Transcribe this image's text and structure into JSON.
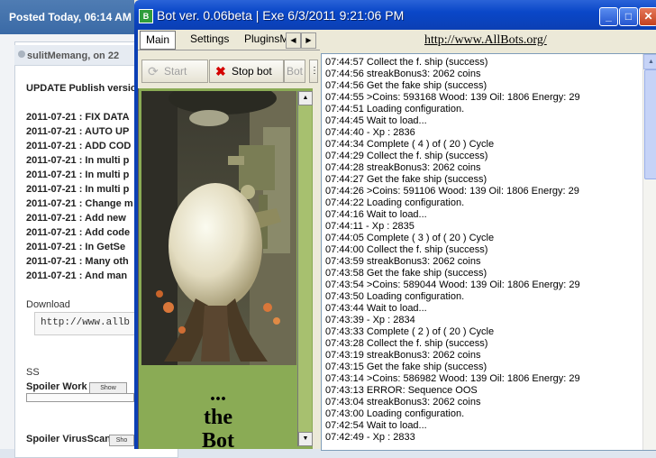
{
  "forum": {
    "posted": "Posted Today, 06:14 AM",
    "username": "sulitMemang, on 22",
    "lines": [
      "UPDATE Publish version",
      "2011-07-21 : FIX DATA",
      "2011-07-21 : AUTO UP",
      "2011-07-21 : ADD COD",
      "2011-07-21 : In multi p",
      "2011-07-21 : In multi p",
      "2011-07-21 : In multi p",
      "2011-07-21 : Change m",
      "2011-07-21 : Add new",
      "2011-07-21 : Add code",
      "2011-07-21 : In GetSe",
      "2011-07-21 : Many oth",
      "2011-07-21 : And man"
    ],
    "download_label": "Download",
    "download_code": "http://www.allb",
    "ss_label": "SS",
    "spoiler1_label": "Spoiler Work",
    "spoiler_button": "Show",
    "spoiler2_label": "Spoiler VirusScan",
    "spoiler2_button": "Sho"
  },
  "window": {
    "title": "Bot ver. 0.06beta | Exe 6/3/2011 9:21:06 PM",
    "app_icon": "bot-icon",
    "minimize_glyph": "_",
    "maximize_glyph": "□",
    "close_glyph": "✕"
  },
  "tabs": [
    "Main",
    "Settings",
    "PluginsMa"
  ],
  "toolbar": {
    "start_label": "Start",
    "stop_label": "Stop bot",
    "bot_label": "Bot",
    "more_label": "⋮"
  },
  "url": "http://www.AllBots.org/",
  "image_caption": [
    "...",
    "the",
    "Bot"
  ],
  "log": [
    "07:44:57 Collect the f. ship (success)",
    "07:44:56 streakBonus3: 2062 coins",
    "07:44:56 Get the fake ship (success)",
    "07:44:55 >Coins: 593168 Wood: 139 Oil: 1806 Energy: 29",
    "07:44:51 Loading configuration.",
    "07:44:45 Wait to load...",
    "07:44:40  - Xp : 2836",
    "07:44:34 Complete ( 4 ) of ( 20 ) Cycle",
    "07:44:29 Collect the f. ship (success)",
    "07:44:28 streakBonus3: 2062 coins",
    "07:44:27 Get the fake ship (success)",
    "07:44:26 >Coins: 591106 Wood: 139 Oil: 1806 Energy: 29",
    "07:44:22 Loading configuration.",
    "07:44:16 Wait to load...",
    "07:44:11  - Xp : 2835",
    "07:44:05 Complete ( 3 ) of ( 20 ) Cycle",
    "07:44:00 Collect the f. ship (success)",
    "07:43:59 streakBonus3: 2062 coins",
    "07:43:58 Get the fake ship (success)",
    "07:43:54 >Coins: 589044 Wood: 139 Oil: 1806 Energy: 29",
    "07:43:50 Loading configuration.",
    "07:43:44 Wait to load...",
    "07:43:39  - Xp : 2834",
    "07:43:33 Complete ( 2 ) of ( 20 ) Cycle",
    "07:43:28 Collect the f. ship (success)",
    "07:43:19 streakBonus3: 2062 coins",
    "07:43:15 Get the fake ship (success)",
    "07:43:14 >Coins: 586982 Wood: 139 Oil: 1806 Energy: 29",
    "07:43:13 ERROR: Sequence OOS",
    "07:43:04 streakBonus3: 2062 coins",
    "07:43:00 Loading configuration.",
    "07:42:54 Wait to load...",
    "07:42:49  - Xp : 2833"
  ]
}
